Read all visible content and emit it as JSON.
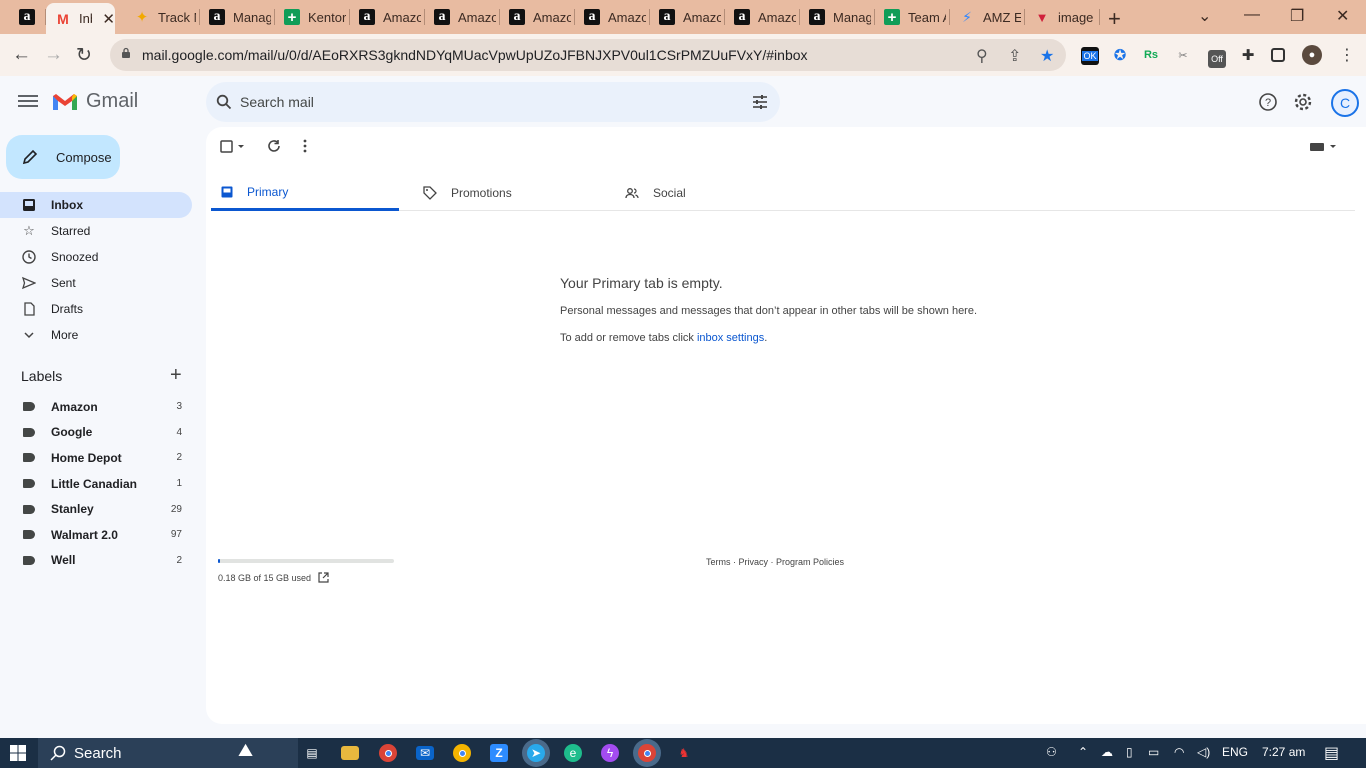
{
  "browser": {
    "tabs": [
      {
        "title": "",
        "favicon": "amazon-icon",
        "kind": "amz"
      },
      {
        "title": "Inb",
        "favicon": "gmail-icon",
        "kind": "gm",
        "active": true
      },
      {
        "title": "Track M",
        "favicon": "track-icon",
        "kind": "track"
      },
      {
        "title": "Manag",
        "favicon": "amazon-icon",
        "kind": "amz"
      },
      {
        "title": "Kentor",
        "favicon": "sheets-icon",
        "kind": "sheet"
      },
      {
        "title": "Amazo",
        "favicon": "amazon-icon",
        "kind": "amz"
      },
      {
        "title": "Amazo",
        "favicon": "amazon-icon",
        "kind": "amz"
      },
      {
        "title": "Amazo",
        "favicon": "amazon-icon",
        "kind": "amz"
      },
      {
        "title": "Amazo",
        "favicon": "amazon-icon",
        "kind": "amz"
      },
      {
        "title": "Amazo",
        "favicon": "amazon-icon",
        "kind": "amz"
      },
      {
        "title": "Amazo",
        "favicon": "amazon-icon",
        "kind": "amz"
      },
      {
        "title": "Manag",
        "favicon": "amazon-icon",
        "kind": "amz"
      },
      {
        "title": "Team A",
        "favicon": "sheets-icon",
        "kind": "sheet"
      },
      {
        "title": "AMZ E",
        "favicon": "zap-icon",
        "kind": "zap"
      },
      {
        "title": "image",
        "favicon": "image-icon",
        "kind": "img"
      }
    ],
    "url": "mail.google.com/mail/u/0/d/AEoRXRS3gkndNDYqMUacVpwUpUZoJFBNJXPV0ul1CSrPMZUuFVxY/#inbox",
    "ext_badges": [
      "OK",
      "Off"
    ]
  },
  "gmail": {
    "brand": "Gmail",
    "search_placeholder": "Search mail",
    "avatar_initial": "C",
    "compose_label": "Compose",
    "nav": [
      {
        "label": "Inbox",
        "icon": "inbox-icon",
        "active": true
      },
      {
        "label": "Starred",
        "icon": "star-icon"
      },
      {
        "label": "Snoozed",
        "icon": "clock-icon"
      },
      {
        "label": "Sent",
        "icon": "send-icon"
      },
      {
        "label": "Drafts",
        "icon": "draft-icon"
      },
      {
        "label": "More",
        "icon": "chevron-down-icon"
      }
    ],
    "labels_header": "Labels",
    "labels": [
      {
        "name": "Amazon",
        "count": "3"
      },
      {
        "name": "Google",
        "count": "4"
      },
      {
        "name": "Home Depot",
        "count": "2"
      },
      {
        "name": "Little Canadian",
        "count": "1"
      },
      {
        "name": "Stanley",
        "count": "29"
      },
      {
        "name": "Walmart 2.0",
        "count": "97"
      },
      {
        "name": "Well",
        "count": "2"
      }
    ],
    "category_tabs": [
      {
        "label": "Primary",
        "icon": "inbox-icon",
        "active": true
      },
      {
        "label": "Promotions",
        "icon": "tag-icon"
      },
      {
        "label": "Social",
        "icon": "people-icon"
      }
    ],
    "empty": {
      "title": "Your Primary tab is empty.",
      "line1": "Personal messages and messages that don’t appear in other tabs will be shown here.",
      "line2_prefix": "To add or remove tabs click ",
      "line2_link": "inbox settings",
      "line2_suffix": "."
    },
    "storage": {
      "text": "0.18 GB of 15 GB used",
      "used_fraction": 0.012
    },
    "footer": "Terms · Privacy · Program Policies"
  },
  "taskbar": {
    "search_label": "Search",
    "lang": "ENG",
    "time": "7:27 am"
  },
  "colors": {
    "tabstrip": "#e8bba1",
    "accent": "#0b57d0",
    "compose_bg": "#c2e7ff",
    "nav_active_bg": "#d3e3fd"
  }
}
